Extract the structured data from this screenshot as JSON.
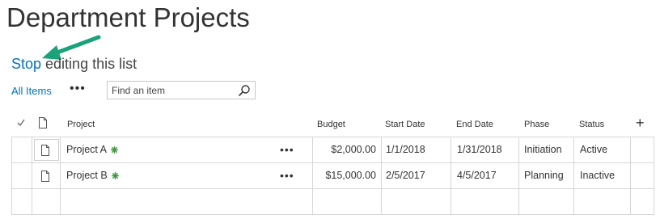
{
  "page": {
    "title": "Department Projects",
    "stop_editing_link": "Stop",
    "stop_editing_rest": " editing this list"
  },
  "toolbar": {
    "view_label": "All Items",
    "more_label": "•••",
    "search_placeholder": "Find an item"
  },
  "columns": {
    "project": "Project",
    "budget": "Budget",
    "start_date": "Start Date",
    "end_date": "End Date",
    "phase": "Phase",
    "status": "Status",
    "add": "+"
  },
  "rows": [
    {
      "project": "Project A",
      "more": "•••",
      "budget": "$2,000.00",
      "start_date": "1/1/2018",
      "end_date": "1/31/2018",
      "phase": "Initiation",
      "status": "Active"
    },
    {
      "project": "Project B",
      "more": "•••",
      "budget": "$15,000.00",
      "start_date": "2/5/2017",
      "end_date": "4/5/2017",
      "phase": "Planning",
      "status": "Inactive"
    }
  ],
  "colors": {
    "link": "#0072c6",
    "annotation_arrow": "#1aa37a",
    "new_badge": "#3a9a3a",
    "grid_border": "#d6d6d6"
  },
  "icons": {
    "check": "checkmark-icon",
    "document": "document-icon",
    "search": "search-icon",
    "new_item": "new-item-icon",
    "annotation": "arrow-icon"
  }
}
